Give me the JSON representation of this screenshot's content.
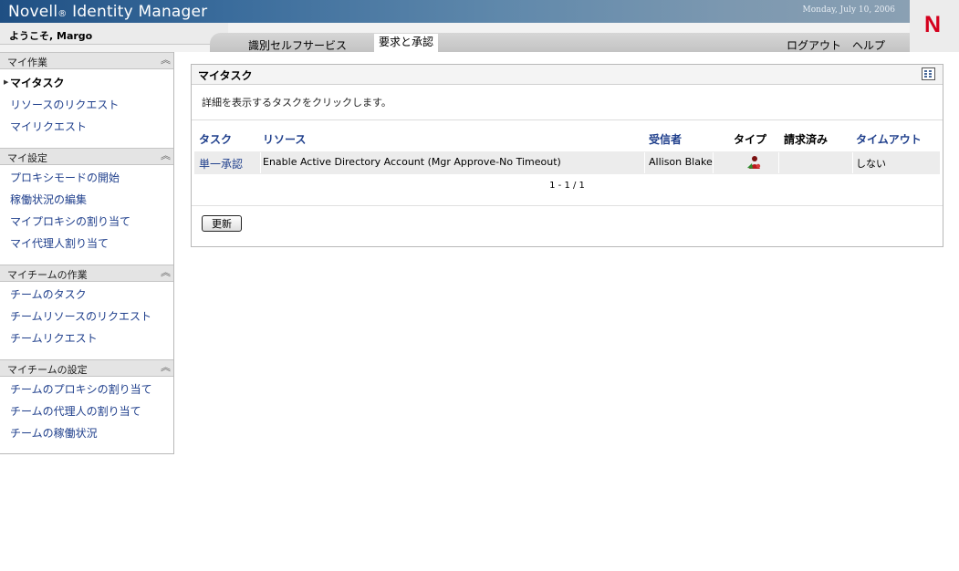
{
  "header": {
    "brand": "Novell",
    "brand_reg": "®",
    "brand_product": " Identity Manager",
    "date": "Monday, July 10, 2006",
    "logo": "N",
    "welcome": "ようこそ, Margo",
    "tabs": [
      "識別セルフサービス",
      "要求と承認"
    ],
    "active_tab": "要求と承認",
    "logout": "ログアウト",
    "help": "ヘルプ"
  },
  "sidebar": {
    "sections": [
      {
        "title": "マイ作業",
        "items": [
          "マイタスク",
          "リソースのリクエスト",
          "マイリクエスト"
        ]
      },
      {
        "title": "マイ設定",
        "items": [
          "プロキシモードの開始",
          "稼働状況の編集",
          "マイプロキシの割り当て",
          "マイ代理人割り当て"
        ]
      },
      {
        "title": "マイチームの作業",
        "items": [
          "チームのタスク",
          "チームリソースのリクエスト",
          "チームリクエスト"
        ]
      },
      {
        "title": "マイチームの設定",
        "items": [
          "チームのプロキシの割り当て",
          "チームの代理人の割り当て",
          "チームの稼働状況"
        ]
      }
    ],
    "collapse_icon": "double-chevron-up-icon",
    "active_item": "マイタスク"
  },
  "main": {
    "title": "マイタスク",
    "description": "詳細を表示するタスクをクリックします。",
    "columns": [
      "タスク",
      "リソース",
      "受信者",
      "タイプ",
      "請求済み",
      "タイムアウト"
    ],
    "rows": [
      {
        "task": "単一承認",
        "resource": "Enable Active Directory Account (Mgr Approve-No Timeout)",
        "recipient": "Allison Blake",
        "type_icon": "user-approval-icon",
        "claimed": "",
        "timeout": "しない"
      }
    ],
    "pager": "1 - 1 / 1",
    "refresh_button": "更新"
  },
  "colors": {
    "link": "#1f3f8c",
    "banner": "#1f4f83",
    "logo_red": "#d4001d"
  }
}
